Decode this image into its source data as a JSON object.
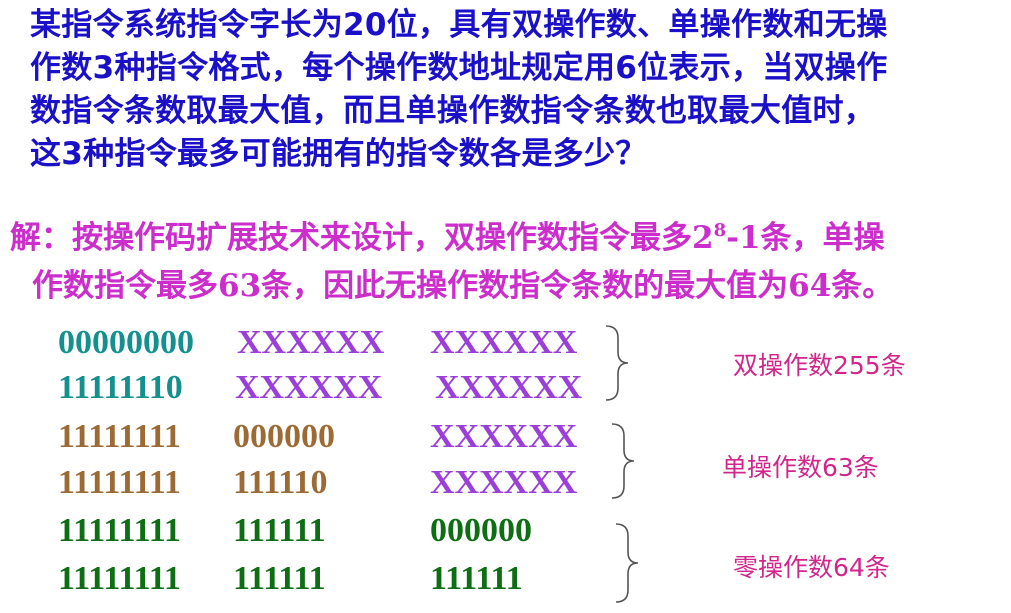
{
  "question": {
    "lines": [
      "某指令系统指令字长为20位，具有双操作数、单操作数和无操",
      "作数3种指令格式，每个操作数地址规定用6位表示，当双操作",
      "数指令条数取最大值，而且单操作数指令条数也取最大值时，",
      "这3种指令最多可能拥有的指令数各是多少？"
    ]
  },
  "answer": {
    "line1_pre": "解：按操作码扩展技术来设计，双操作数指令最多2",
    "line1_sup": "8",
    "line1_post": "-1条，单操",
    "line2": "作数指令最多63条，因此无操作数指令条数的最大值为64条。"
  },
  "encoding": {
    "rows": [
      {
        "op": "00000000",
        "a1": "XXXXXX",
        "a2": "XXXXXX"
      },
      {
        "op": "11111110",
        "a1": "XXXXXX",
        "a2": "XXXXXX"
      },
      {
        "op": "11111111",
        "a1": "000000",
        "a2": "XXXXXX"
      },
      {
        "op": "11111111",
        "a1": "111110",
        "a2": "XXXXXX"
      },
      {
        "op": "11111111",
        "a1": "111111",
        "a2": "000000"
      },
      {
        "op": "11111111",
        "a1": "111111",
        "a2": "111111"
      }
    ],
    "labels": [
      "双操作数255条",
      "单操作数63条",
      "零操作数64条"
    ]
  },
  "colors": {
    "question": "#1a10c8",
    "answer": "#cc2ecc",
    "teal": "#14908e",
    "violet": "#9a40d8",
    "brown": "#9c6a34",
    "green": "#0e6e14",
    "label": "#d1268c"
  }
}
